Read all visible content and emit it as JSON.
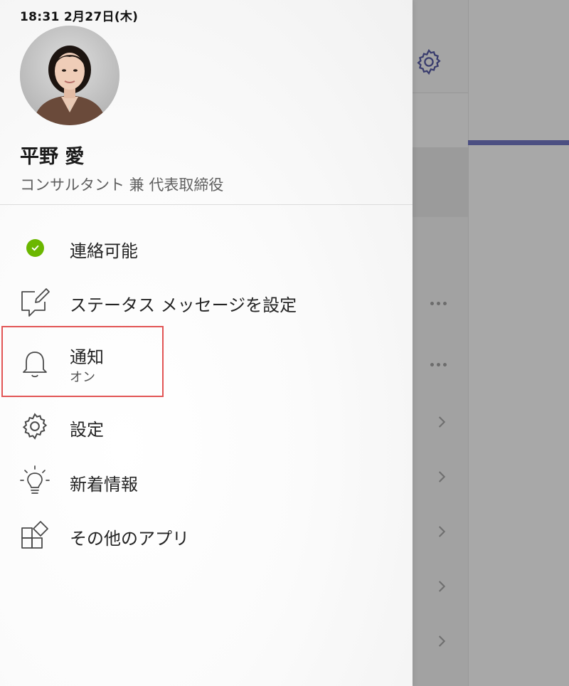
{
  "status_bar": {
    "time_date": "18:31   2月27日(木)"
  },
  "profile": {
    "name": "平野 愛",
    "title": "コンサルタント 兼 代表取締役"
  },
  "menu": [
    {
      "id": "availability",
      "label": "連絡可能",
      "icon": "available-status-icon",
      "status_color": "#6bb700"
    },
    {
      "id": "status-message",
      "label": "ステータス メッセージを設定",
      "icon": "edit-message-icon"
    },
    {
      "id": "notifications",
      "label": "通知",
      "sublabel": "オン",
      "icon": "bell-icon",
      "highlighted": true,
      "highlight_color": "#e25555"
    },
    {
      "id": "settings",
      "label": "設定",
      "icon": "gear-icon"
    },
    {
      "id": "whats-new",
      "label": "新着情報",
      "icon": "lightbulb-icon"
    },
    {
      "id": "more-apps",
      "label": "その他のアプリ",
      "icon": "apps-icon"
    }
  ],
  "background": {
    "accent_color": "#4c4f82",
    "icons": [
      "gear-icon",
      "more-icon",
      "more-icon",
      "chevron-right-icon",
      "chevron-right-icon",
      "chevron-right-icon",
      "chevron-right-icon",
      "chevron-right-icon"
    ]
  }
}
